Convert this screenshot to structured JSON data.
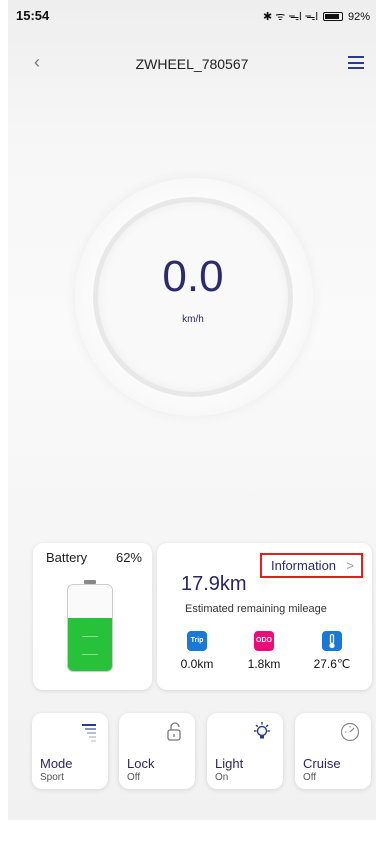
{
  "status_bar": {
    "time": "15:54",
    "icons": "✱ ᯤ ᯓl ᯓl",
    "battery": "92%"
  },
  "header": {
    "title": "ZWHEEL_780567",
    "back_icon": "‹"
  },
  "speedometer": {
    "speed": "0.0",
    "unit": "km/h"
  },
  "battery": {
    "label": "Battery",
    "percent": "62%",
    "level": 0.62,
    "color": "#27c13a"
  },
  "info": {
    "link_label": "Information",
    "link_chevron": ">",
    "range": "17.9km",
    "range_label": "Estimated remaining mileage",
    "metrics": [
      {
        "icon_text": "Trip",
        "value": "0.0km"
      },
      {
        "icon_text": "ODO",
        "value": "1.8km"
      },
      {
        "icon_text": "",
        "value": "27.6℃"
      }
    ]
  },
  "controls": [
    {
      "label": "Mode",
      "value": "Sport"
    },
    {
      "label": "Lock",
      "value": "Off"
    },
    {
      "label": "Light",
      "value": "On"
    },
    {
      "label": "Cruise",
      "value": "Off"
    }
  ]
}
